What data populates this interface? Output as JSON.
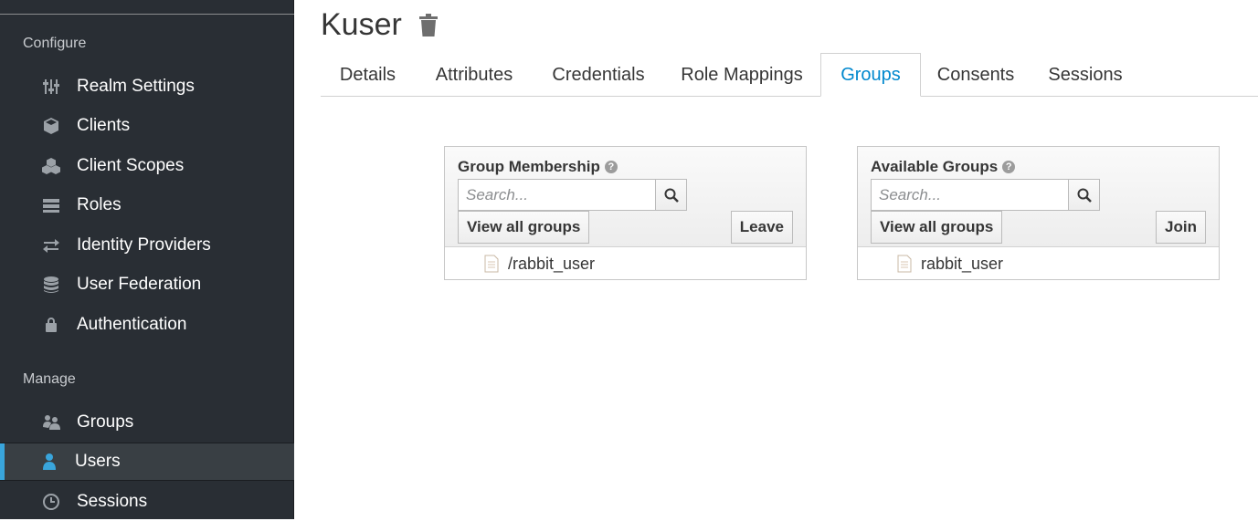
{
  "sidebar": {
    "configure_title": "Configure",
    "configure_items": [
      {
        "label": "Realm Settings",
        "icon": "sliders-icon"
      },
      {
        "label": "Clients",
        "icon": "cube-icon"
      },
      {
        "label": "Client Scopes",
        "icon": "cubes-icon"
      },
      {
        "label": "Roles",
        "icon": "list-icon"
      },
      {
        "label": "Identity Providers",
        "icon": "exchange-icon"
      },
      {
        "label": "User Federation",
        "icon": "database-icon"
      },
      {
        "label": "Authentication",
        "icon": "lock-icon"
      }
    ],
    "manage_title": "Manage",
    "manage_items": [
      {
        "label": "Groups",
        "icon": "users-icon"
      },
      {
        "label": "Users",
        "icon": "user-icon",
        "active": true
      },
      {
        "label": "Sessions",
        "icon": "clock-icon"
      }
    ]
  },
  "header": {
    "title": "Kuser"
  },
  "tabs": [
    {
      "label": "Details"
    },
    {
      "label": "Attributes"
    },
    {
      "label": "Credentials"
    },
    {
      "label": "Role Mappings"
    },
    {
      "label": "Groups",
      "active": true
    },
    {
      "label": "Consents"
    },
    {
      "label": "Sessions"
    }
  ],
  "group_membership": {
    "title": "Group Membership",
    "search_placeholder": "Search...",
    "view_all_label": "View all groups",
    "action_label": "Leave",
    "items": [
      "/rabbit_user"
    ]
  },
  "available_groups": {
    "title": "Available Groups",
    "search_placeholder": "Search...",
    "view_all_label": "View all groups",
    "action_label": "Join",
    "items": [
      "rabbit_user"
    ]
  },
  "colors": {
    "sidebar_bg": "#292e34",
    "accent": "#39a5dc",
    "active_tab": "#0088ce"
  }
}
